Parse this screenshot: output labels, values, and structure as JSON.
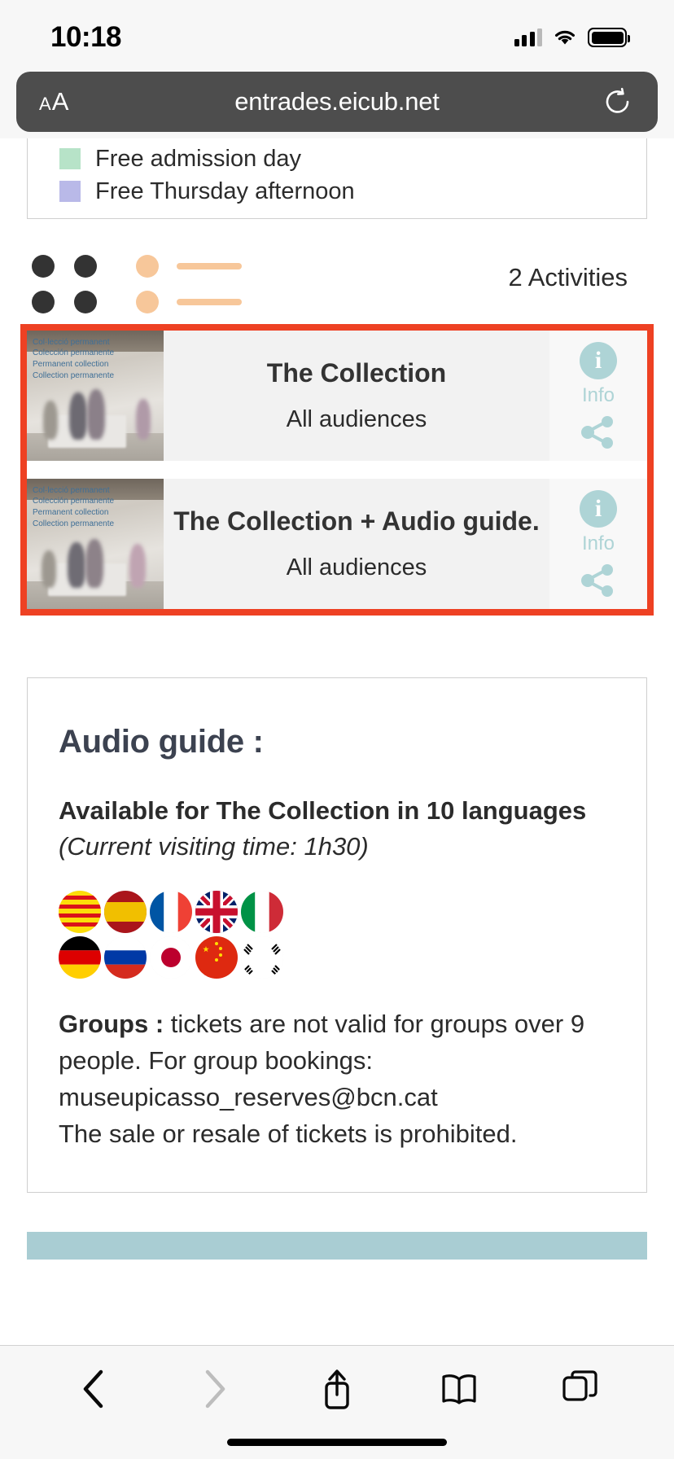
{
  "status_bar": {
    "time": "10:18",
    "signal_icon": "cellular-signal-icon",
    "wifi_icon": "wifi-icon",
    "battery_icon": "battery-full-icon"
  },
  "browser": {
    "text_size_small": "A",
    "text_size_large": "A",
    "url": "entrades.eicub.net",
    "reload_icon": "reload-icon"
  },
  "legend": {
    "items": [
      {
        "label": "Free admission day",
        "color": "#b7e3c8"
      },
      {
        "label": "Free Thursday afternoon",
        "color": "#b9b9e8"
      }
    ]
  },
  "loader": {
    "activities_count": "2 Activities"
  },
  "activities": [
    {
      "title": "The Collection",
      "audience": "All audiences",
      "info_label": "Info",
      "info_icon": "info-icon",
      "share_icon": "share-icon",
      "thumb_lines": [
        "Col·lecció permanent",
        "Colección permanente",
        "Permanent collection",
        "Collection permanente"
      ]
    },
    {
      "title": "The Collection + Audio guide.",
      "audience": "All audiences",
      "info_label": "Info",
      "info_icon": "info-icon",
      "share_icon": "share-icon",
      "thumb_lines": [
        "Col·lecció permanent",
        "Colección permanente",
        "Permanent collection",
        "Collection permanente"
      ]
    }
  ],
  "audio_guide": {
    "title": "Audio guide :",
    "available": "Available for The Collection in 10 languages",
    "visiting_time": "(Current visiting time: 1h30)",
    "flags_row1": [
      "catalan-flag",
      "spanish-flag",
      "french-flag",
      "uk-flag",
      "italian-flag"
    ],
    "flags_row2": [
      "german-flag",
      "russian-flag",
      "japanese-flag",
      "chinese-flag",
      "korean-flag"
    ],
    "groups_label": "Groups :",
    "groups_text": " tickets are not valid for groups over 9 people. For group bookings: museupicasso_reserves@bcn.cat",
    "resale_text": "The sale or resale of tickets is prohibited."
  },
  "toolbar": {
    "back_icon": "chevron-left-icon",
    "forward_icon": "chevron-right-icon",
    "share_icon": "share-up-icon",
    "bookmarks_icon": "book-icon",
    "tabs_icon": "tabs-icon"
  },
  "colors": {
    "highlight_border": "#ee4123",
    "accent_teal": "#aed4d6",
    "skeleton_orange": "#f7c79a"
  }
}
